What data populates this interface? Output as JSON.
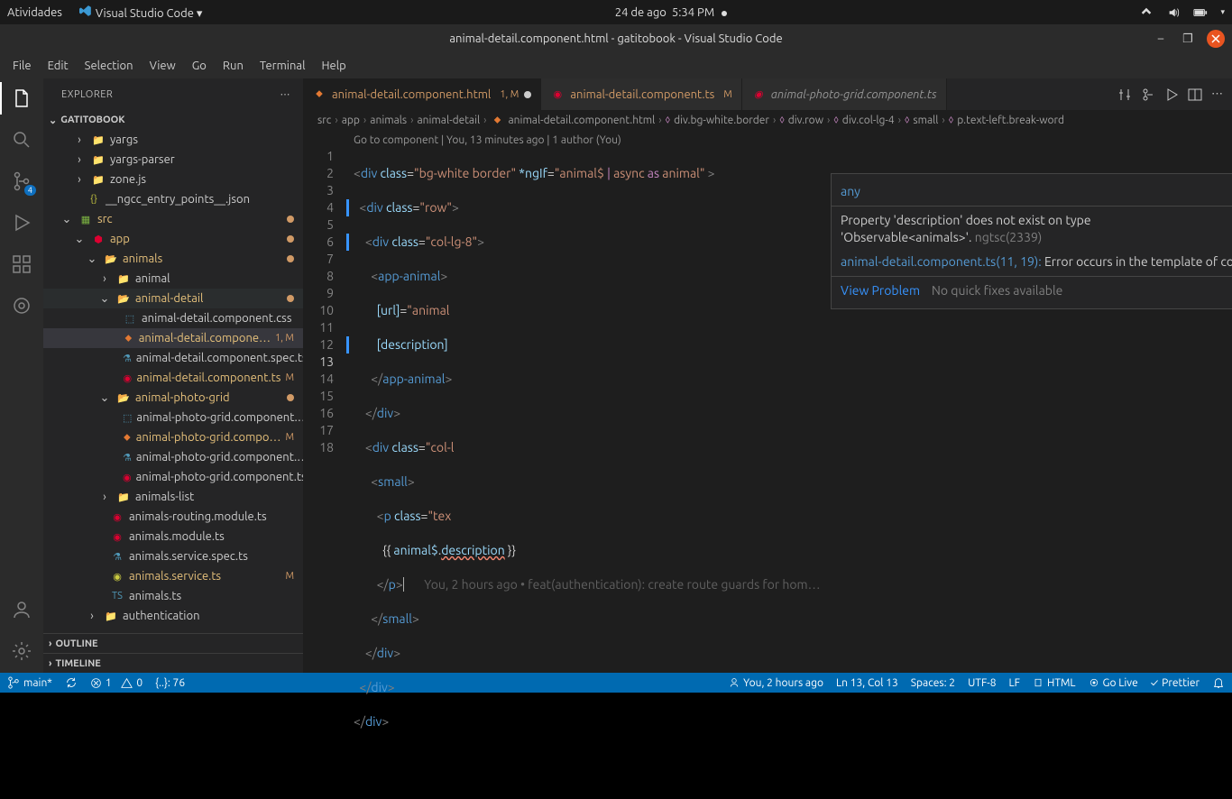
{
  "os": {
    "activities": "Atividades",
    "app": "Visual Studio Code ▾",
    "date": "24 de ago",
    "time": "5:34 PM"
  },
  "window": {
    "title": "animal-detail.component.html - gatitobook - Visual Studio Code"
  },
  "menu": [
    "File",
    "Edit",
    "Selection",
    "View",
    "Go",
    "Run",
    "Terminal",
    "Help"
  ],
  "explorer": {
    "title": "EXPLORER",
    "project": "GATITOBOOK",
    "outline": "OUTLINE",
    "timeline": "TIMELINE",
    "items": {
      "yargs": "yargs",
      "yargsparser": "yargs-parser",
      "zone": "zone.js",
      "ngcc": "__ngcc_entry_points__.json",
      "src": "src",
      "app": "app",
      "animals": "animals",
      "animal": "animal",
      "animaldetail": "animal-detail",
      "adcss": "animal-detail.component.css",
      "adhtml": "animal-detail.compone…",
      "adspec": "animal-detail.component.spec.ts",
      "adts": "animal-detail.component.ts",
      "apg": "animal-photo-grid",
      "apgcss": "animal-photo-grid.component.…",
      "apghtml": "animal-photo-grid.compo…",
      "apgspec": "animal-photo-grid.component.…",
      "apgts": "animal-photo-grid.component.ts",
      "alist": "animals-list",
      "arouting": "animals-routing.module.ts",
      "amodule": "animals.module.ts",
      "asvcspec": "animals.service.spec.ts",
      "asvc": "animals.service.ts",
      "ats": "animals.ts",
      "auth": "authentication"
    },
    "m": "M",
    "onem": "1, M"
  },
  "tabs": {
    "t1": "animal-detail.component.html",
    "t1s": "1, M",
    "t2": "animal-detail.component.ts",
    "t2s": "M",
    "t3": "animal-photo-grid.component.ts"
  },
  "crumbs": {
    "c1": "src",
    "c2": "app",
    "c3": "animals",
    "c4": "animal-detail",
    "c5": "animal-detail.component.html",
    "c6": "div.bg-white.border",
    "c7": "div.row",
    "c8": "div.col-lg-4",
    "c9": "small",
    "c10": "p.text-left.break-word"
  },
  "codelens": {
    "goto": "Go to component",
    "blame": "You, 13 minutes ago",
    "authors": "1 author (You)"
  },
  "code": {
    "inline_lens": "You, 2 hours ago • feat(authentication): create route guards for hom…"
  },
  "hover": {
    "type": "any",
    "msg1": "Property 'description' does not exist on type",
    "msg2": "'Observable<animals>'.",
    "msg2code": "ngtsc(2339)",
    "loc": "animal-detail.component.ts(11, 19):",
    "msg3": " Error occurs in the template of component AnimalDetailComponent.",
    "view": "View Problem",
    "noquick": "No quick fixes available"
  },
  "status": {
    "branch": "main*",
    "sync": "0",
    "err": "1",
    "warn": "0",
    "braces": "{..}: 76",
    "blame": "You, 2 hours ago",
    "pos": "Ln 13, Col 13",
    "spaces": "Spaces: 2",
    "enc": "UTF-8",
    "eol": "LF",
    "lang": "HTML",
    "golive": "Go Live",
    "prettier": "Prettier"
  }
}
